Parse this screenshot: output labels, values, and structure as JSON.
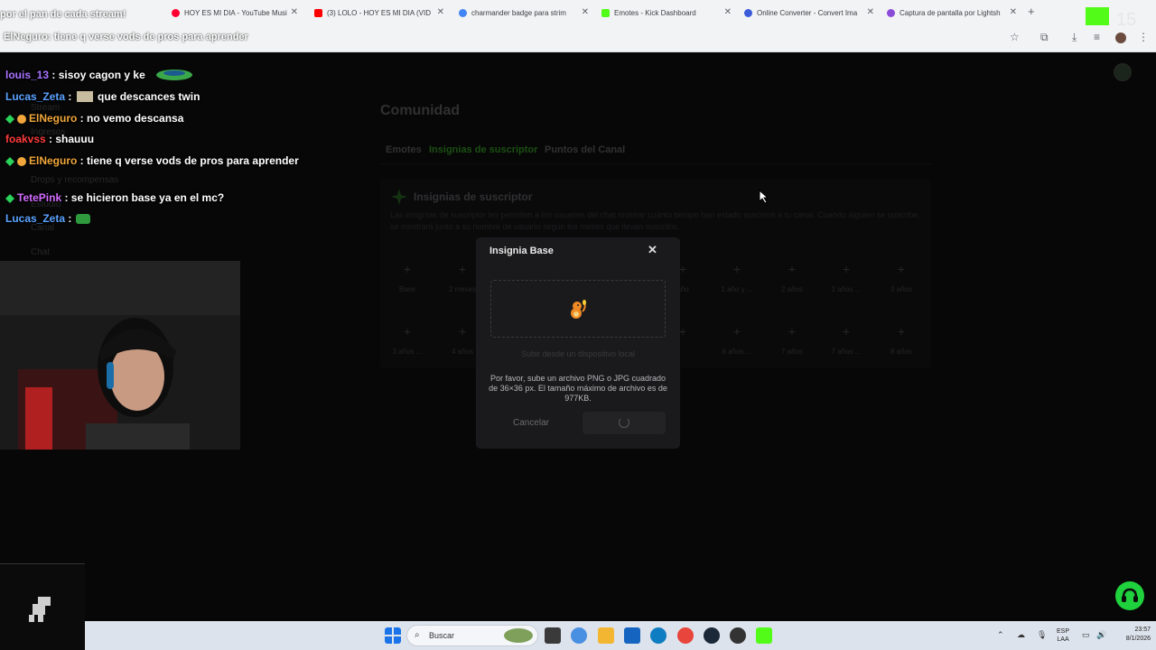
{
  "browser": {
    "tabs": [
      {
        "title": "HOY ES MI DIA - YouTube Musi",
        "color": "#ff0033"
      },
      {
        "title": "(3) LOLO - HOY ES MI DIA (VID",
        "color": "#ff0000"
      },
      {
        "title": "charmander badge para strim",
        "color": "#4285f4"
      },
      {
        "title": "Emotes - Kick Dashboard",
        "color": "#53fc18"
      },
      {
        "title": "Online Converter - Convert Ima",
        "color": "#3b5bdb"
      },
      {
        "title": "Captura de pantalla por Lightsh",
        "color": "#8a4bd8"
      }
    ],
    "new_tab_label": "+"
  },
  "kick": {
    "sidebar": {
      "stream": "Stream",
      "ingresos": "Ingresos",
      "drops": "Drops y recompensas",
      "estudio": "Estudio",
      "canal": "Canal",
      "chat": "Chat"
    },
    "page_title": "Comunidad",
    "tabs": [
      "Emotes",
      "Insignias de suscriptor",
      "Puntos del Canal"
    ],
    "active_tab": "Insignias de suscriptor",
    "panel": {
      "title": "Insignias de suscriptor",
      "description": "Las insignias de suscriptor les permiten a los usuarios del chat mostrar cuánto tiempo han estado suscritos a tu canal. Cuando alguien se suscribe, se mostrará junto a su nombre de usuario según los meses que llevan suscritos."
    },
    "slots_row1": [
      "Base",
      "2 meses",
      "",
      "",
      "",
      "1 año y ...",
      "2 años",
      "2 años ...",
      "3 años"
    ],
    "slots_row2": [
      "3 años ...",
      "4 años",
      "",
      "",
      "",
      "6 años ...",
      "7 años",
      "7 años ...",
      "8 años"
    ]
  },
  "modal": {
    "title": "Insignia Base",
    "close": "✕",
    "upload_hint": "Subir desde un dispositivo local",
    "info": "Por favor, sube un archivo PNG o JPG cuadrado de 36×36 px. El tamaño máximo de archivo es de 977KB.",
    "cancel": "Cancelar"
  },
  "chat": {
    "ticker_top": "por el pan de cada stream!",
    "ticker_user_line": "ElNeguro: tiene q verse vods de pros para aprender",
    "messages": [
      {
        "user": "louis_13",
        "text": "sisoy cagon y ke",
        "color": "#a974ff"
      },
      {
        "user": "Lucas_Zeta",
        "text": "que descances twin",
        "color": "#5ba3ff"
      },
      {
        "user": "ElNeguro",
        "text": "no vemo descansa",
        "color": "#f0a63a"
      },
      {
        "user": "foakvss",
        "text": "shauuu",
        "color": "#ff3b3b"
      },
      {
        "user": "ElNeguro",
        "text": "tiene q verse vods de pros para aprender",
        "color": "#f0a63a"
      },
      {
        "user": "TetePink",
        "text": "se hicieron base ya en el mc?",
        "color": "#d46cff"
      },
      {
        "user": "Lucas_Zeta",
        "text": "",
        "color": "#5ba3ff"
      }
    ]
  },
  "taskbar": {
    "search_placeholder": "Buscar",
    "lang_top": "ESP",
    "lang_bottom": "LAA",
    "time": "23:57",
    "date": "8/1/2026"
  }
}
